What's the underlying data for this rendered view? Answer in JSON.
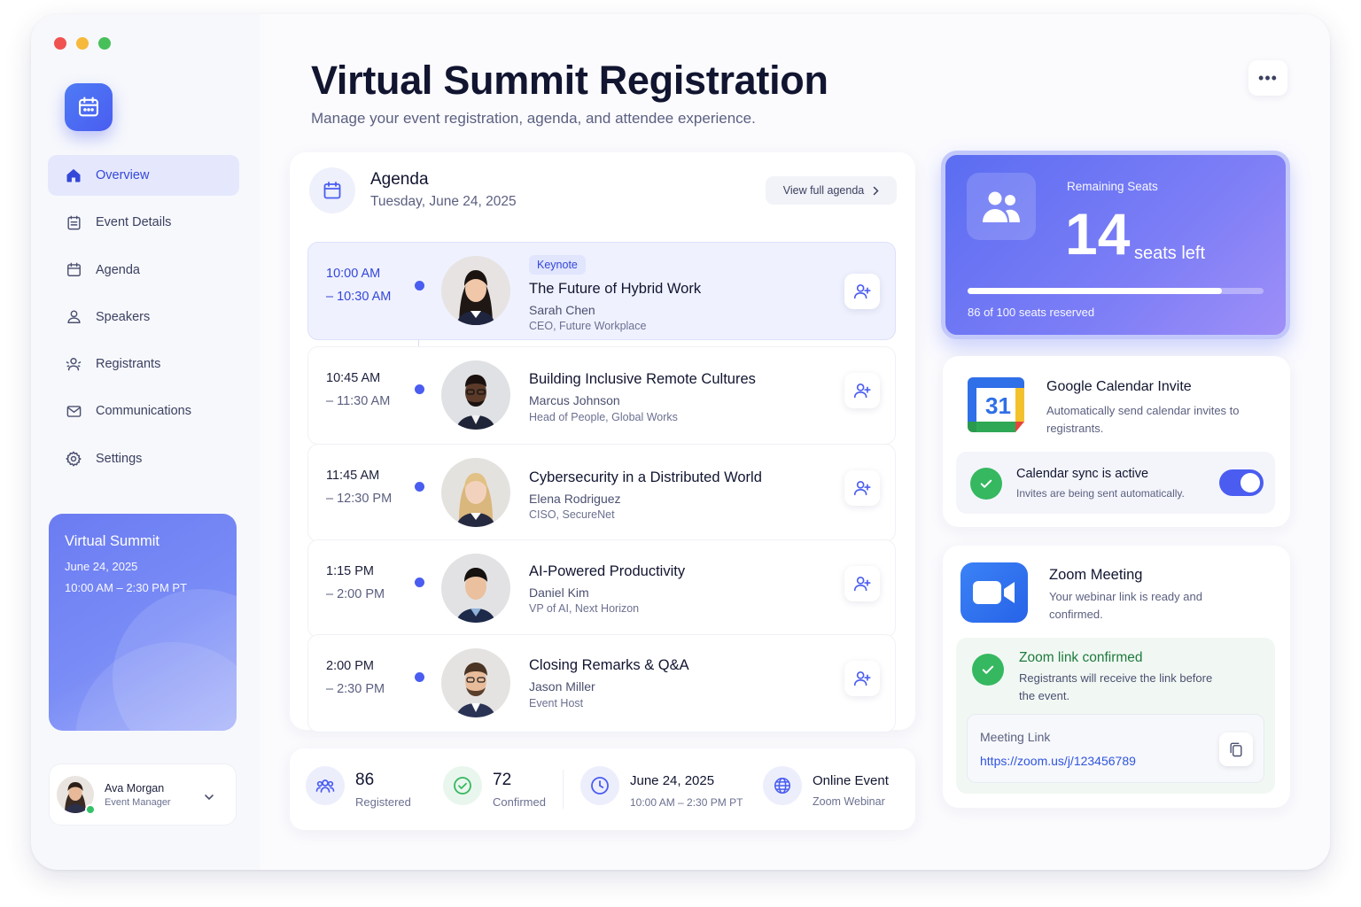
{
  "colors": {
    "accent": "#4a5df0",
    "accent_light": "#e5e8fd",
    "success": "#35b860",
    "zoom_blue": "#2d6cf0"
  },
  "sidebar": {
    "logo_icon": "calendar-icon",
    "items": [
      {
        "label": "Overview",
        "icon": "home-icon",
        "active": true
      },
      {
        "label": "Event Details",
        "icon": "clipboard-icon",
        "active": false
      },
      {
        "label": "Agenda",
        "icon": "calendar-icon",
        "active": false
      },
      {
        "label": "Speakers",
        "icon": "user-icon",
        "active": false
      },
      {
        "label": "Registrants",
        "icon": "users-icon",
        "active": false
      },
      {
        "label": "Communications",
        "icon": "mail-icon",
        "active": false
      },
      {
        "label": "Settings",
        "icon": "gear-icon",
        "active": false
      }
    ],
    "promo": {
      "title": "Virtual Summit",
      "date": "June 24, 2025",
      "time": "10:00 AM – 2:30 PM PT"
    },
    "user": {
      "name": "Ava Morgan",
      "role": "Event Manager",
      "status": "online"
    }
  },
  "header": {
    "title": "Virtual Summit Registration",
    "subtitle": "Manage your event registration, agenda, and attendee experience.",
    "more_icon": "more-horizontal-icon"
  },
  "agenda": {
    "title": "Agenda",
    "date": "Tuesday, June 24, 2025",
    "view_all_label": "View full agenda",
    "sessions": [
      {
        "start": "10:00 AM",
        "end": "– 10:30 AM",
        "badge": "Keynote",
        "title": "The Future of Hybrid Work",
        "speaker": "Sarah Chen",
        "role": "CEO, Future Workplace",
        "featured": true
      },
      {
        "start": "10:45 AM",
        "end": "– 11:30 AM",
        "badge": "",
        "title": "Building Inclusive Remote Cultures",
        "speaker": "Marcus Johnson",
        "role": "Head of People, Global Works",
        "featured": false
      },
      {
        "start": "11:45 AM",
        "end": "– 12:30 PM",
        "badge": "",
        "title": "Cybersecurity in a Distributed World",
        "speaker": "Elena Rodriguez",
        "role": "CISO, SecureNet",
        "featured": false
      },
      {
        "start": "1:15 PM",
        "end": "– 2:00 PM",
        "badge": "",
        "title": "AI-Powered Productivity",
        "speaker": "Daniel Kim",
        "role": "VP of AI, Next Horizon",
        "featured": false
      },
      {
        "start": "2:00 PM",
        "end": "– 2:30 PM",
        "badge": "",
        "title": "Closing Remarks & Q&A",
        "speaker": "Jason Miller",
        "role": "Event Host",
        "featured": false
      }
    ]
  },
  "stats": {
    "registered": {
      "value": "86",
      "label": "Registered"
    },
    "confirmed": {
      "value": "72",
      "label": "Confirmed"
    },
    "schedule": {
      "date": "June 24, 2025",
      "time": "10:00 AM – 2:30 PM PT"
    },
    "format": {
      "type": "Online Event",
      "platform": "Zoom Webinar"
    }
  },
  "seats": {
    "label": "Remaining Seats",
    "remaining": "14",
    "unit": "seats left",
    "reserved_text": "86 of 100 seats reserved",
    "reserved_fraction": 0.86
  },
  "google_calendar": {
    "title": "Google Calendar Invite",
    "description": "Automatically send calendar invites to registrants.",
    "logo_text": "31",
    "sync_title": "Calendar sync is active",
    "sync_sub": "Invites are being sent automatically.",
    "sync_enabled": true
  },
  "zoom": {
    "title": "Zoom Meeting",
    "description": "Your webinar link is ready and confirmed.",
    "confirmed_title": "Zoom link confirmed",
    "confirmed_desc": "Registrants will receive the link before the event.",
    "link_label": "Meeting Link",
    "link_url": "https://zoom.us/j/123456789"
  }
}
